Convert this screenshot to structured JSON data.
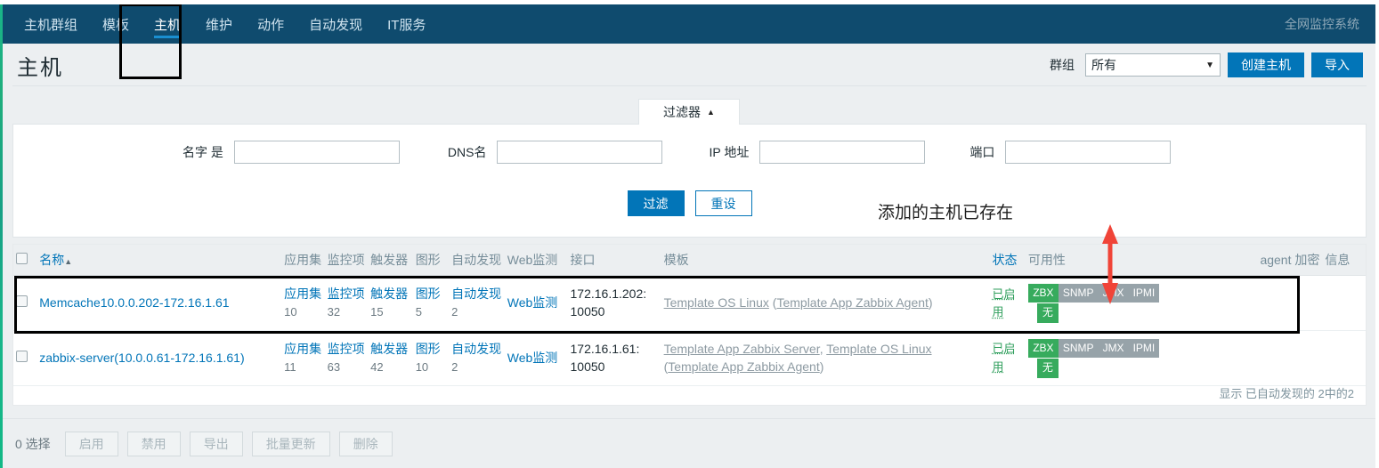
{
  "nav": {
    "items": [
      {
        "label": "主机群组",
        "active": false
      },
      {
        "label": "模板",
        "active": false
      },
      {
        "label": "主机",
        "active": true
      },
      {
        "label": "维护",
        "active": false
      },
      {
        "label": "动作",
        "active": false
      },
      {
        "label": "自动发现",
        "active": false
      },
      {
        "label": "IT服务",
        "active": false
      }
    ],
    "brand": "全网监控系统"
  },
  "header": {
    "title": "主机",
    "group_label": "群组",
    "group_value": "所有",
    "create_host_label": "创建主机",
    "import_label": "导入"
  },
  "filter": {
    "tab_label": "过滤器",
    "tab_caret": "▲",
    "name_label": "名字 是",
    "name_value": "",
    "dns_label": "DNS名",
    "dns_value": "",
    "ip_label": "IP 地址",
    "ip_value": "",
    "port_label": "端口",
    "port_value": "",
    "apply_label": "过滤",
    "reset_label": "重设"
  },
  "annotation": {
    "text": "添加的主机已存在",
    "color": "#f04438"
  },
  "table": {
    "headers": {
      "name": "名称",
      "sort_arrow": "▲",
      "applications": "应用集",
      "items": "监控项",
      "triggers": "触发器",
      "graphs": "图形",
      "discovery": "自动发现",
      "web": "Web监测",
      "interface": "接口",
      "templates": "模板",
      "status": "状态",
      "availability": "可用性",
      "agent_encryption": "agent 加密",
      "info": "信息"
    },
    "rows": [
      {
        "name": "Memcache10.0.0.202-172.16.1.61",
        "applications_label": "应用集",
        "applications_count": "10",
        "items_label": "监控项",
        "items_count": "32",
        "triggers_label": "触发器",
        "triggers_count": "15",
        "graphs_label": "图形",
        "graphs_count": "5",
        "discovery_label": "自动发现",
        "discovery_count": "2",
        "web_label": "Web监测",
        "interface": "172.16.1.202: 10050",
        "templates": [
          {
            "text": "Template OS Linux",
            "link": true
          },
          {
            "text": " (",
            "link": false
          },
          {
            "text": "Template App Zabbix Agent",
            "link": true
          },
          {
            "text": ")",
            "link": false
          }
        ],
        "status": "已启用",
        "availability": [
          {
            "label": "ZBX",
            "state": "on"
          },
          {
            "label": "SNMP",
            "state": "off"
          },
          {
            "label": "JMX",
            "state": "off"
          },
          {
            "label": "IPMI",
            "state": "off"
          }
        ],
        "encryption": "无",
        "info": ""
      },
      {
        "name": "zabbix-server(10.0.0.61-172.16.1.61)",
        "applications_label": "应用集",
        "applications_count": "11",
        "items_label": "监控项",
        "items_count": "63",
        "triggers_label": "触发器",
        "triggers_count": "42",
        "graphs_label": "图形",
        "graphs_count": "10",
        "discovery_label": "自动发现",
        "discovery_count": "2",
        "web_label": "Web监测",
        "interface": "172.16.1.61: 10050",
        "templates": [
          {
            "text": "Template App Zabbix Server",
            "link": true
          },
          {
            "text": ", ",
            "link": false
          },
          {
            "text": "Template OS Linux",
            "link": true
          },
          {
            "text": " (",
            "link": false
          },
          {
            "text": "Template App Zabbix Agent",
            "link": true
          },
          {
            "text": ")",
            "link": false
          }
        ],
        "status": "已启用",
        "availability": [
          {
            "label": "ZBX",
            "state": "on"
          },
          {
            "label": "SNMP",
            "state": "off"
          },
          {
            "label": "JMX",
            "state": "off"
          },
          {
            "label": "IPMI",
            "state": "off"
          }
        ],
        "encryption": "无",
        "info": ""
      }
    ],
    "summary": "显示 已自动发现的 2中的2"
  },
  "footer": {
    "selection": "0 选择",
    "buttons": [
      "启用",
      "禁用",
      "导出",
      "批量更新",
      "删除"
    ]
  }
}
